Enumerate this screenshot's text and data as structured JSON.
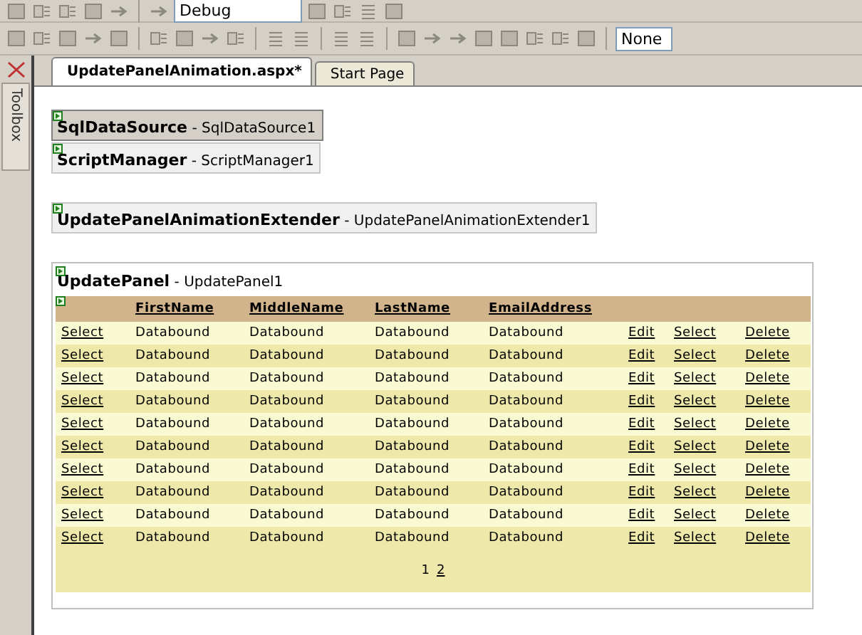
{
  "toolbar_top": {
    "config_dropdown": "Debug"
  },
  "toolbar_format": {
    "style_dropdown": "None"
  },
  "tabs": [
    {
      "label": "UpdatePanelAnimation.aspx*",
      "selected": true
    },
    {
      "label": "Start Page",
      "selected": false
    }
  ],
  "toolbox": {
    "label": "Toolbox"
  },
  "controls": [
    {
      "type": "SqlDataSource",
      "separator": "-",
      "id": "SqlDataSource1",
      "selected": true
    },
    {
      "type": "ScriptManager",
      "separator": "-",
      "id": "ScriptManager1",
      "selected": false
    },
    {
      "type": "UpdatePanelAnimationExtender",
      "separator": "-",
      "id": "UpdatePanelAnimationExtender1",
      "selected": false
    }
  ],
  "update_panel": {
    "type": "UpdatePanel",
    "separator": "-",
    "id": "UpdatePanel1",
    "grid": {
      "columns": [
        "",
        "FirstName",
        "MiddleName",
        "LastName",
        "EmailAddress",
        "",
        "",
        ""
      ],
      "rows": [
        [
          "Select",
          "Databound",
          "Databound",
          "Databound",
          "Databound",
          "Edit",
          "Select",
          "Delete"
        ],
        [
          "Select",
          "Databound",
          "Databound",
          "Databound",
          "Databound",
          "Edit",
          "Select",
          "Delete"
        ],
        [
          "Select",
          "Databound",
          "Databound",
          "Databound",
          "Databound",
          "Edit",
          "Select",
          "Delete"
        ],
        [
          "Select",
          "Databound",
          "Databound",
          "Databound",
          "Databound",
          "Edit",
          "Select",
          "Delete"
        ],
        [
          "Select",
          "Databound",
          "Databound",
          "Databound",
          "Databound",
          "Edit",
          "Select",
          "Delete"
        ],
        [
          "Select",
          "Databound",
          "Databound",
          "Databound",
          "Databound",
          "Edit",
          "Select",
          "Delete"
        ],
        [
          "Select",
          "Databound",
          "Databound",
          "Databound",
          "Databound",
          "Edit",
          "Select",
          "Delete"
        ],
        [
          "Select",
          "Databound",
          "Databound",
          "Databound",
          "Databound",
          "Edit",
          "Select",
          "Delete"
        ],
        [
          "Select",
          "Databound",
          "Databound",
          "Databound",
          "Databound",
          "Edit",
          "Select",
          "Delete"
        ],
        [
          "Select",
          "Databound",
          "Databound",
          "Databound",
          "Databound",
          "Edit",
          "Select",
          "Delete"
        ]
      ],
      "pages": [
        {
          "label": "1",
          "selected": true
        },
        {
          "label": "2",
          "selected": false
        }
      ]
    }
  }
}
